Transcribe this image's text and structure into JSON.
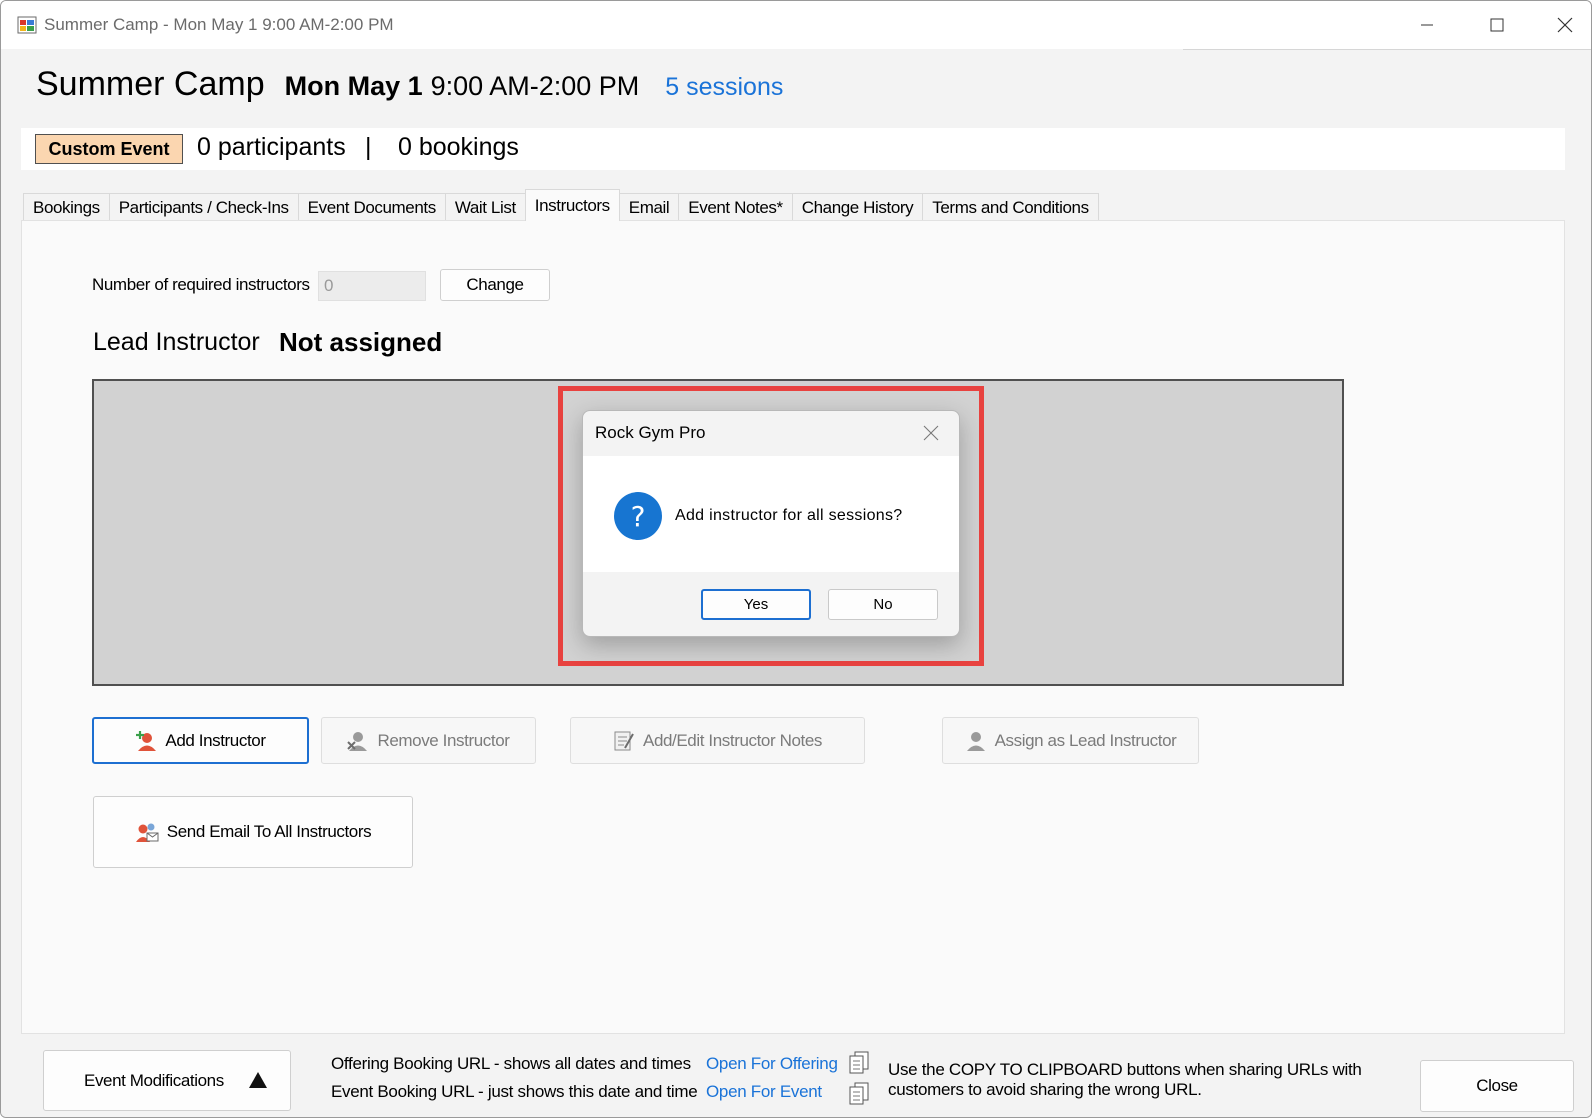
{
  "window": {
    "title": "Summer Camp - Mon May 1 9:00 AM-2:00 PM"
  },
  "header": {
    "event_name": "Summer Camp",
    "event_day": "Mon May 1",
    "event_time": "9:00 AM-2:00 PM",
    "sessions_link": "5 sessions"
  },
  "summary": {
    "event_type_badge": "Custom Event",
    "participants": "0 participants",
    "separator": "|",
    "bookings": "0 bookings"
  },
  "tabs": [
    {
      "label": "Bookings"
    },
    {
      "label": "Participants / Check-Ins"
    },
    {
      "label": "Event Documents"
    },
    {
      "label": "Wait List"
    },
    {
      "label": "Instructors"
    },
    {
      "label": "Email"
    },
    {
      "label": "Event Notes*"
    },
    {
      "label": "Change History"
    },
    {
      "label": "Terms and Conditions"
    }
  ],
  "instructors_tab": {
    "required_label": "Number of required instructors",
    "required_value": "0",
    "change_button": "Change",
    "lead_label": "Lead Instructor",
    "lead_value": "Not assigned",
    "add_instructor": "Add Instructor",
    "remove_instructor": "Remove Instructor",
    "edit_notes": "Add/Edit Instructor Notes",
    "assign_lead": "Assign as Lead Instructor",
    "send_email": "Send Email To All Instructors"
  },
  "dialog": {
    "title": "Rock Gym Pro",
    "message": "Add instructor for all sessions?",
    "yes_button": "Yes",
    "no_button": "No",
    "icon": "question-icon"
  },
  "bottom_bar": {
    "event_modifications": "Event Modifications",
    "offering_url_label": "Offering Booking URL - shows all dates and times",
    "event_url_label": "Event Booking URL - just shows this date and time",
    "open_for_offering": "Open For Offering",
    "open_for_event": "Open For Event",
    "clipboard_note_line1": "Use the COPY TO CLIPBOARD buttons when sharing URLs with",
    "clipboard_note_line2": "customers to avoid sharing the wrong URL.",
    "close_button": "Close"
  },
  "colors": {
    "accent_blue": "#1a73d8",
    "badge_bg": "#fbd6b0",
    "highlight_red": "#e8423f",
    "icon_red": "#e0533a"
  }
}
